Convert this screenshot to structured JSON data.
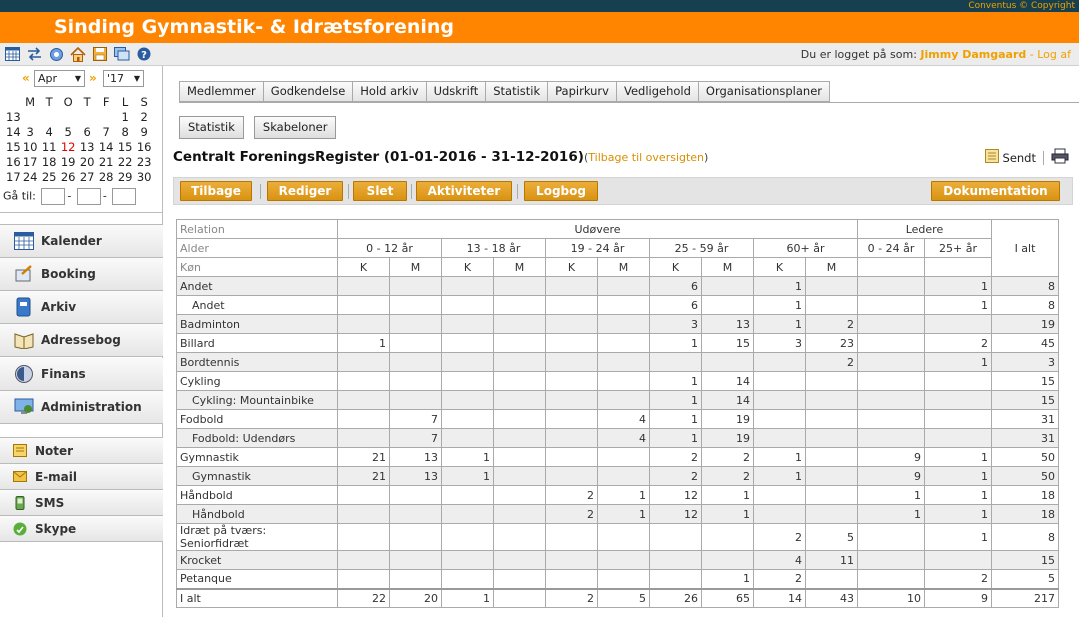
{
  "topbar": {
    "copyright": "Conventus © Copyright"
  },
  "header": {
    "title": "Sinding Gymnastik- & Idrætsforening"
  },
  "userbar": {
    "prefix": "Du er logget på som:",
    "user": "Jimmy Damgaard",
    "sep": "-",
    "logout": "Log af"
  },
  "calendar": {
    "month": "Apr",
    "year": "'17",
    "prev": "«",
    "next": "»",
    "weekdays": [
      "M",
      "T",
      "O",
      "T",
      "F",
      "L",
      "S"
    ],
    "weeks": [
      {
        "wk": "13",
        "days": [
          "",
          "",
          "",
          "",
          "",
          "1",
          "2"
        ]
      },
      {
        "wk": "14",
        "days": [
          "3",
          "4",
          "5",
          "6",
          "7",
          "8",
          "9"
        ]
      },
      {
        "wk": "15",
        "days": [
          "10",
          "11",
          "12",
          "13",
          "14",
          "15",
          "16"
        ]
      },
      {
        "wk": "16",
        "days": [
          "17",
          "18",
          "19",
          "20",
          "21",
          "22",
          "23"
        ]
      },
      {
        "wk": "17",
        "days": [
          "24",
          "25",
          "26",
          "27",
          "28",
          "29",
          "30"
        ]
      }
    ],
    "today": "12",
    "goto_label": "Gå til:",
    "goto_dash": "-"
  },
  "menu": [
    {
      "label": "Kalender",
      "icon": "calendar-icon"
    },
    {
      "label": "Booking",
      "icon": "booking-icon"
    },
    {
      "label": "Arkiv",
      "icon": "archive-icon"
    },
    {
      "label": "Adressebog",
      "icon": "address-book-icon"
    },
    {
      "label": "Finans",
      "icon": "finance-icon"
    },
    {
      "label": "Administration",
      "icon": "administration-icon"
    }
  ],
  "submenu": [
    {
      "label": "Noter",
      "icon": "note-icon"
    },
    {
      "label": "E-mail",
      "icon": "email-icon"
    },
    {
      "label": "SMS",
      "icon": "sms-icon"
    },
    {
      "label": "Skype",
      "icon": "skype-icon"
    }
  ],
  "tabs": [
    "Medlemmer",
    "Godkendelse",
    "Hold arkiv",
    "Udskrift",
    "Statistik",
    "Papirkurv",
    "Vedligehold",
    "Organisationsplaner"
  ],
  "subtabs": [
    "Statistik",
    "Skabeloner"
  ],
  "page": {
    "title": "Centralt ForeningsRegister (01-01-2016 - 31-12-2016)",
    "back_open": "(",
    "back_link": "Tilbage til oversigten",
    "back_close": ")",
    "sent_label": "Sendt"
  },
  "actions": {
    "back": "Tilbage",
    "edit": "Rediger",
    "delete": "Slet",
    "activities": "Aktiviteter",
    "logbook": "Logbog",
    "documentation": "Dokumentation"
  },
  "table": {
    "row_labels": {
      "relation": "Relation",
      "age": "Alder",
      "gender": "Køn"
    },
    "group_udovere": "Udøvere",
    "group_ledere": "Ledere",
    "total_header": "I alt",
    "age_groups": [
      "0 - 12 år",
      "13 - 18 år",
      "19 - 24 år",
      "25 - 59 år",
      "60+ år"
    ],
    "leader_groups": [
      "0 - 24 år",
      "25+ år"
    ],
    "gender": {
      "k": "K",
      "m": "M"
    },
    "rows": [
      {
        "name": "Andet",
        "sub": false,
        "v": [
          "",
          "",
          "",
          "",
          "",
          "",
          "6",
          "",
          "1",
          "",
          "",
          "1",
          "8"
        ]
      },
      {
        "name": "Andet",
        "sub": true,
        "v": [
          "",
          "",
          "",
          "",
          "",
          "",
          "6",
          "",
          "1",
          "",
          "",
          "1",
          "8"
        ]
      },
      {
        "name": "Badminton",
        "sub": false,
        "v": [
          "",
          "",
          "",
          "",
          "",
          "",
          "3",
          "13",
          "1",
          "2",
          "",
          "",
          "19"
        ]
      },
      {
        "name": "Billard",
        "sub": false,
        "v": [
          "1",
          "",
          "",
          "",
          "",
          "",
          "1",
          "15",
          "3",
          "23",
          "",
          "2",
          "45"
        ]
      },
      {
        "name": "Bordtennis",
        "sub": false,
        "v": [
          "",
          "",
          "",
          "",
          "",
          "",
          "",
          "",
          "",
          "2",
          "",
          "1",
          "3"
        ]
      },
      {
        "name": "Cykling",
        "sub": false,
        "v": [
          "",
          "",
          "",
          "",
          "",
          "",
          "1",
          "14",
          "",
          "",
          "",
          "",
          "15"
        ]
      },
      {
        "name": "Cykling: Mountainbike",
        "sub": true,
        "v": [
          "",
          "",
          "",
          "",
          "",
          "",
          "1",
          "14",
          "",
          "",
          "",
          "",
          "15"
        ]
      },
      {
        "name": "Fodbold",
        "sub": false,
        "v": [
          "",
          "7",
          "",
          "",
          "",
          "4",
          "1",
          "19",
          "",
          "",
          "",
          "",
          "31"
        ]
      },
      {
        "name": "Fodbold: Udendørs",
        "sub": true,
        "v": [
          "",
          "7",
          "",
          "",
          "",
          "4",
          "1",
          "19",
          "",
          "",
          "",
          "",
          "31"
        ]
      },
      {
        "name": "Gymnastik",
        "sub": false,
        "v": [
          "21",
          "13",
          "1",
          "",
          "",
          "",
          "2",
          "2",
          "1",
          "",
          "9",
          "1",
          "50"
        ]
      },
      {
        "name": "Gymnastik",
        "sub": true,
        "v": [
          "21",
          "13",
          "1",
          "",
          "",
          "",
          "2",
          "2",
          "1",
          "",
          "9",
          "1",
          "50"
        ]
      },
      {
        "name": "Håndbold",
        "sub": false,
        "v": [
          "",
          "",
          "",
          "",
          "2",
          "1",
          "12",
          "1",
          "",
          "",
          "1",
          "1",
          "18"
        ]
      },
      {
        "name": "Håndbold",
        "sub": true,
        "v": [
          "",
          "",
          "",
          "",
          "2",
          "1",
          "12",
          "1",
          "",
          "",
          "1",
          "1",
          "18"
        ]
      },
      {
        "name": "Idræt på tværs: Seniorfidræt",
        "sub": false,
        "v": [
          "",
          "",
          "",
          "",
          "",
          "",
          "",
          "",
          "2",
          "5",
          "",
          "1",
          "8"
        ]
      },
      {
        "name": "Krocket",
        "sub": false,
        "v": [
          "",
          "",
          "",
          "",
          "",
          "",
          "",
          "",
          "4",
          "11",
          "",
          "",
          "15"
        ]
      },
      {
        "name": "Petanque",
        "sub": false,
        "v": [
          "",
          "",
          "",
          "",
          "",
          "",
          "",
          "1",
          "2",
          "",
          "",
          "2",
          "5"
        ]
      }
    ],
    "total": {
      "name": "I alt",
      "v": [
        "22",
        "20",
        "1",
        "",
        "2",
        "5",
        "26",
        "65",
        "14",
        "43",
        "10",
        "9",
        "217"
      ]
    }
  }
}
